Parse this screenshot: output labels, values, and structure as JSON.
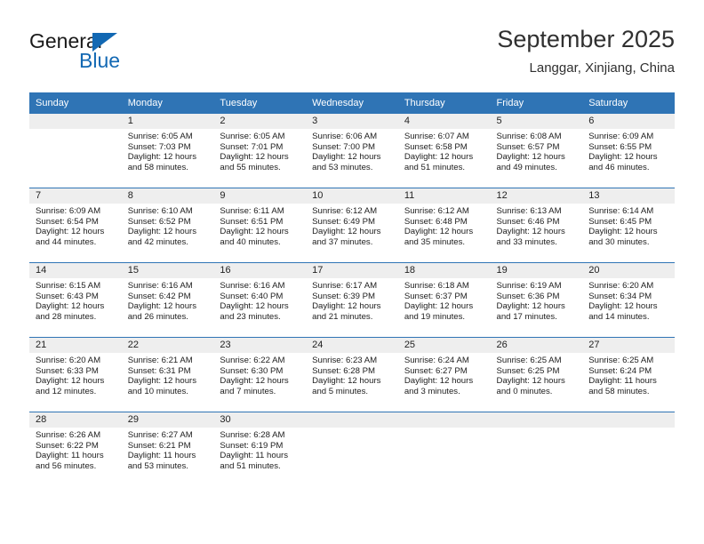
{
  "brand": {
    "name_top": "General",
    "name_bottom": "Blue",
    "accent_color": "#1268b3"
  },
  "header": {
    "title": "September 2025",
    "subtitle": "Langgar, Xinjiang, China"
  },
  "calendar": {
    "header_color": "#2f74b5",
    "daynum_strip_color": "#eeeeee",
    "weekday_names": [
      "Sunday",
      "Monday",
      "Tuesday",
      "Wednesday",
      "Thursday",
      "Friday",
      "Saturday"
    ],
    "weeks": [
      [
        {
          "empty": true
        },
        {
          "day": "1",
          "sunrise": "Sunrise: 6:05 AM",
          "sunset": "Sunset: 7:03 PM",
          "daylight_1": "Daylight: 12 hours",
          "daylight_2": "and 58 minutes."
        },
        {
          "day": "2",
          "sunrise": "Sunrise: 6:05 AM",
          "sunset": "Sunset: 7:01 PM",
          "daylight_1": "Daylight: 12 hours",
          "daylight_2": "and 55 minutes."
        },
        {
          "day": "3",
          "sunrise": "Sunrise: 6:06 AM",
          "sunset": "Sunset: 7:00 PM",
          "daylight_1": "Daylight: 12 hours",
          "daylight_2": "and 53 minutes."
        },
        {
          "day": "4",
          "sunrise": "Sunrise: 6:07 AM",
          "sunset": "Sunset: 6:58 PM",
          "daylight_1": "Daylight: 12 hours",
          "daylight_2": "and 51 minutes."
        },
        {
          "day": "5",
          "sunrise": "Sunrise: 6:08 AM",
          "sunset": "Sunset: 6:57 PM",
          "daylight_1": "Daylight: 12 hours",
          "daylight_2": "and 49 minutes."
        },
        {
          "day": "6",
          "sunrise": "Sunrise: 6:09 AM",
          "sunset": "Sunset: 6:55 PM",
          "daylight_1": "Daylight: 12 hours",
          "daylight_2": "and 46 minutes."
        }
      ],
      [
        {
          "day": "7",
          "sunrise": "Sunrise: 6:09 AM",
          "sunset": "Sunset: 6:54 PM",
          "daylight_1": "Daylight: 12 hours",
          "daylight_2": "and 44 minutes."
        },
        {
          "day": "8",
          "sunrise": "Sunrise: 6:10 AM",
          "sunset": "Sunset: 6:52 PM",
          "daylight_1": "Daylight: 12 hours",
          "daylight_2": "and 42 minutes."
        },
        {
          "day": "9",
          "sunrise": "Sunrise: 6:11 AM",
          "sunset": "Sunset: 6:51 PM",
          "daylight_1": "Daylight: 12 hours",
          "daylight_2": "and 40 minutes."
        },
        {
          "day": "10",
          "sunrise": "Sunrise: 6:12 AM",
          "sunset": "Sunset: 6:49 PM",
          "daylight_1": "Daylight: 12 hours",
          "daylight_2": "and 37 minutes."
        },
        {
          "day": "11",
          "sunrise": "Sunrise: 6:12 AM",
          "sunset": "Sunset: 6:48 PM",
          "daylight_1": "Daylight: 12 hours",
          "daylight_2": "and 35 minutes."
        },
        {
          "day": "12",
          "sunrise": "Sunrise: 6:13 AM",
          "sunset": "Sunset: 6:46 PM",
          "daylight_1": "Daylight: 12 hours",
          "daylight_2": "and 33 minutes."
        },
        {
          "day": "13",
          "sunrise": "Sunrise: 6:14 AM",
          "sunset": "Sunset: 6:45 PM",
          "daylight_1": "Daylight: 12 hours",
          "daylight_2": "and 30 minutes."
        }
      ],
      [
        {
          "day": "14",
          "sunrise": "Sunrise: 6:15 AM",
          "sunset": "Sunset: 6:43 PM",
          "daylight_1": "Daylight: 12 hours",
          "daylight_2": "and 28 minutes."
        },
        {
          "day": "15",
          "sunrise": "Sunrise: 6:16 AM",
          "sunset": "Sunset: 6:42 PM",
          "daylight_1": "Daylight: 12 hours",
          "daylight_2": "and 26 minutes."
        },
        {
          "day": "16",
          "sunrise": "Sunrise: 6:16 AM",
          "sunset": "Sunset: 6:40 PM",
          "daylight_1": "Daylight: 12 hours",
          "daylight_2": "and 23 minutes."
        },
        {
          "day": "17",
          "sunrise": "Sunrise: 6:17 AM",
          "sunset": "Sunset: 6:39 PM",
          "daylight_1": "Daylight: 12 hours",
          "daylight_2": "and 21 minutes."
        },
        {
          "day": "18",
          "sunrise": "Sunrise: 6:18 AM",
          "sunset": "Sunset: 6:37 PM",
          "daylight_1": "Daylight: 12 hours",
          "daylight_2": "and 19 minutes."
        },
        {
          "day": "19",
          "sunrise": "Sunrise: 6:19 AM",
          "sunset": "Sunset: 6:36 PM",
          "daylight_1": "Daylight: 12 hours",
          "daylight_2": "and 17 minutes."
        },
        {
          "day": "20",
          "sunrise": "Sunrise: 6:20 AM",
          "sunset": "Sunset: 6:34 PM",
          "daylight_1": "Daylight: 12 hours",
          "daylight_2": "and 14 minutes."
        }
      ],
      [
        {
          "day": "21",
          "sunrise": "Sunrise: 6:20 AM",
          "sunset": "Sunset: 6:33 PM",
          "daylight_1": "Daylight: 12 hours",
          "daylight_2": "and 12 minutes."
        },
        {
          "day": "22",
          "sunrise": "Sunrise: 6:21 AM",
          "sunset": "Sunset: 6:31 PM",
          "daylight_1": "Daylight: 12 hours",
          "daylight_2": "and 10 minutes."
        },
        {
          "day": "23",
          "sunrise": "Sunrise: 6:22 AM",
          "sunset": "Sunset: 6:30 PM",
          "daylight_1": "Daylight: 12 hours",
          "daylight_2": "and 7 minutes."
        },
        {
          "day": "24",
          "sunrise": "Sunrise: 6:23 AM",
          "sunset": "Sunset: 6:28 PM",
          "daylight_1": "Daylight: 12 hours",
          "daylight_2": "and 5 minutes."
        },
        {
          "day": "25",
          "sunrise": "Sunrise: 6:24 AM",
          "sunset": "Sunset: 6:27 PM",
          "daylight_1": "Daylight: 12 hours",
          "daylight_2": "and 3 minutes."
        },
        {
          "day": "26",
          "sunrise": "Sunrise: 6:25 AM",
          "sunset": "Sunset: 6:25 PM",
          "daylight_1": "Daylight: 12 hours",
          "daylight_2": "and 0 minutes."
        },
        {
          "day": "27",
          "sunrise": "Sunrise: 6:25 AM",
          "sunset": "Sunset: 6:24 PM",
          "daylight_1": "Daylight: 11 hours",
          "daylight_2": "and 58 minutes."
        }
      ],
      [
        {
          "day": "28",
          "sunrise": "Sunrise: 6:26 AM",
          "sunset": "Sunset: 6:22 PM",
          "daylight_1": "Daylight: 11 hours",
          "daylight_2": "and 56 minutes."
        },
        {
          "day": "29",
          "sunrise": "Sunrise: 6:27 AM",
          "sunset": "Sunset: 6:21 PM",
          "daylight_1": "Daylight: 11 hours",
          "daylight_2": "and 53 minutes."
        },
        {
          "day": "30",
          "sunrise": "Sunrise: 6:28 AM",
          "sunset": "Sunset: 6:19 PM",
          "daylight_1": "Daylight: 11 hours",
          "daylight_2": "and 51 minutes."
        },
        {
          "empty": true
        },
        {
          "empty": true
        },
        {
          "empty": true
        },
        {
          "empty": true
        }
      ]
    ]
  }
}
